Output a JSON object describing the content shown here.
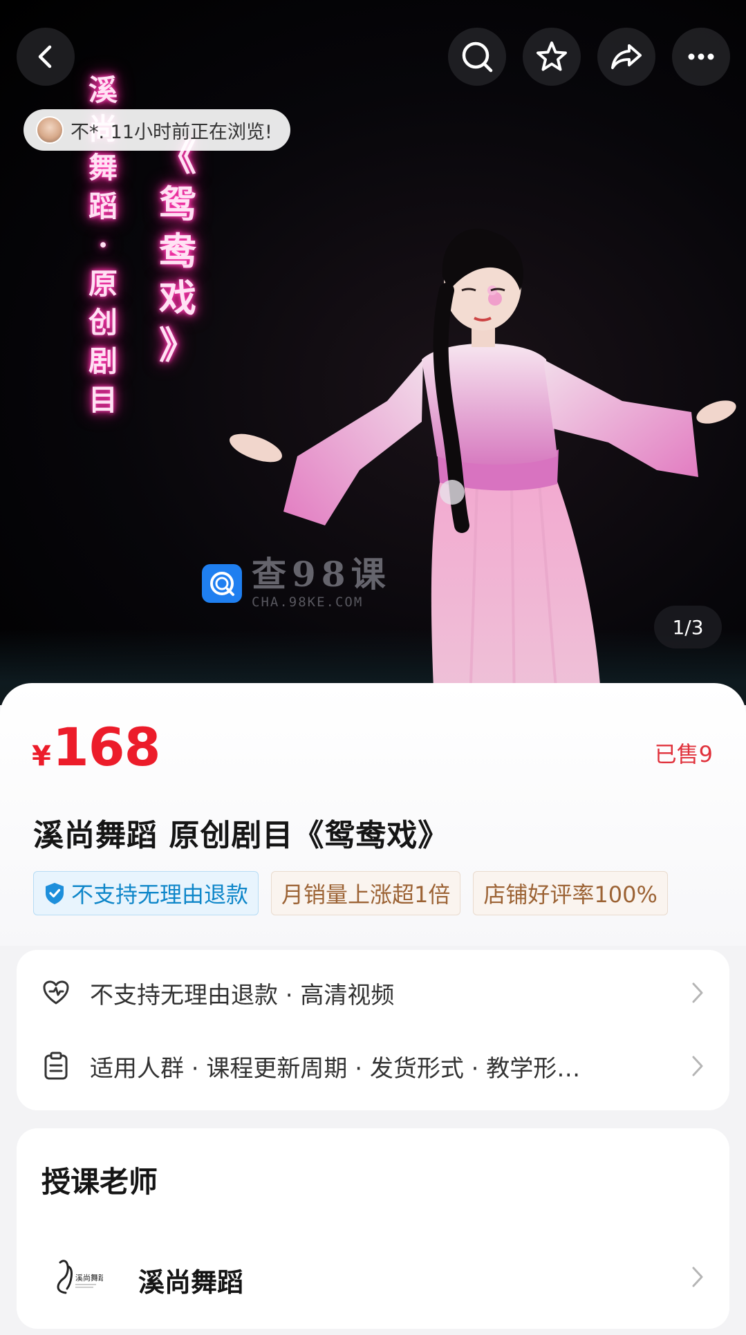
{
  "hero": {
    "neon_left": [
      "溪",
      "尚",
      "舞",
      "蹈",
      "·",
      "原",
      "创",
      "剧",
      "目"
    ],
    "neon_right": [
      "《",
      "鸳",
      "鸯",
      "戏",
      "》"
    ],
    "watermark": {
      "main": "查98课",
      "sub": "CHA.98KE.COM"
    },
    "viewer_notice": "不*. 11小时前正在浏览!",
    "page_indicator": "1/3",
    "icons": [
      "back-arrow-icon",
      "search-icon",
      "star-icon",
      "share-icon",
      "more-icon"
    ]
  },
  "product": {
    "currency": "¥",
    "price": "168",
    "sold": "已售9",
    "title": "溪尚舞蹈 原创剧目《鸳鸯戏》",
    "tags": [
      {
        "text": "不支持无理由退款",
        "style": "blue"
      },
      {
        "text": "月销量上涨超1倍",
        "style": "brown"
      },
      {
        "text": "店铺好评率100%",
        "style": "brown"
      }
    ]
  },
  "services": [
    {
      "text": "不支持无理由退款 · 高清视频",
      "icon": "heart-shield-icon"
    },
    {
      "text": "适用人群 · 课程更新周期 · 发货形式 · 教学形…",
      "icon": "clipboard-icon"
    }
  ],
  "teacher": {
    "heading": "授课老师",
    "name": "溪尚舞蹈",
    "logo_text": "溪尚舞蹈"
  },
  "colors": {
    "price_red": "#ec1c2a",
    "tag_blue": "#0e86c9",
    "tag_brown": "#9c6335",
    "neon_pink": "#ff2fa6"
  }
}
